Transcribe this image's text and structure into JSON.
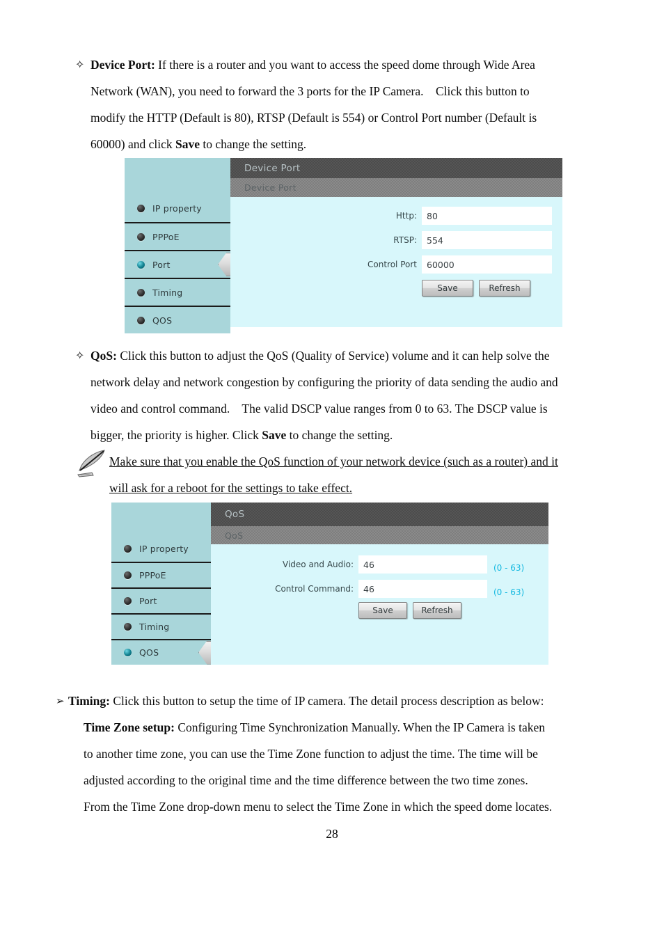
{
  "page": {
    "number": "28"
  },
  "paragraphs": {
    "device_port": {
      "bullet": "✧",
      "term": "Device Port:",
      "lines": [
        " If there is a router and you want to access the speed dome through Wide Area",
        "Network (WAN), you need to forward the 3 ports for the IP Camera.    Click this button to",
        "modify the HTTP (Default is 80), RTSP (Default is 554) or Control Port number (Default is",
        "60000) and click "
      ],
      "save_bold": "Save",
      "line4_tail": " to change the setting."
    },
    "qos": {
      "bullet": "✧",
      "term": "QoS:",
      "lines": [
        " Click this button to adjust the QoS (Quality of Service) volume and it can help solve the",
        "network delay and network congestion by configuring the priority of data sending the audio and",
        "video and control command.    The valid DSCP value ranges from 0 to 63. The DSCP value is",
        "bigger, the priority is higher. Click "
      ],
      "save_bold": "Save",
      "line4_tail": " to change the setting.",
      "note_icon": "feather-pen-icon",
      "note_lines": [
        "Make sure that you enable the QoS function of your network device (such as a router) and it",
        "will ask for a reboot for the settings to take effect."
      ]
    },
    "timing": {
      "bullet": "➢",
      "term": "Timing:",
      "line1_tail": " Click this button to setup the time of IP camera. The detail process description as below:",
      "subterm": "Time Zone setup:",
      "lines": [
        " Configuring Time Synchronization Manually. When the IP Camera is taken",
        "to another time zone, you can use the Time Zone function to adjust the time. The time will be",
        "adjusted according to the original time and the time difference between the two time zones.",
        "From the Time Zone drop-down menu to select the Time Zone in which the speed dome locates."
      ]
    }
  },
  "panels": {
    "device_port": {
      "title": "Device Port",
      "subtitle": "Device Port",
      "sidebar": [
        {
          "label": "IP property",
          "active": false
        },
        {
          "label": "PPPoE",
          "active": false
        },
        {
          "label": "Port",
          "active": true
        },
        {
          "label": "Timing",
          "active": false
        },
        {
          "label": "QOS",
          "active": false
        }
      ],
      "fields": [
        {
          "label": "Http:",
          "value": "80",
          "hint": ""
        },
        {
          "label": "RTSP:",
          "value": "554",
          "hint": ""
        },
        {
          "label": "Control Port",
          "value": "60000",
          "hint": ""
        }
      ],
      "buttons": {
        "save": "Save",
        "refresh": "Refresh"
      }
    },
    "qos": {
      "title": "QoS",
      "subtitle": "QoS",
      "sidebar": [
        {
          "label": "IP property",
          "active": false
        },
        {
          "label": "PPPoE",
          "active": false
        },
        {
          "label": "Port",
          "active": false
        },
        {
          "label": "Timing",
          "active": false
        },
        {
          "label": "QOS",
          "active": true
        }
      ],
      "fields": [
        {
          "label": "Video and Audio:",
          "value": "46",
          "hint": "(0 - 63)"
        },
        {
          "label": "Control Command:",
          "value": "46",
          "hint": "(0 - 63)"
        }
      ],
      "buttons": {
        "save": "Save",
        "refresh": "Refresh"
      }
    }
  },
  "colors": {
    "panel_bg": "#d8f7fb",
    "sidebar_bg": "#a9d6da",
    "titlebar": "#4c4c4c",
    "subbar": "#7e7e7e",
    "hint_teal": "#13b8e0",
    "active_dot": "#11808f"
  }
}
